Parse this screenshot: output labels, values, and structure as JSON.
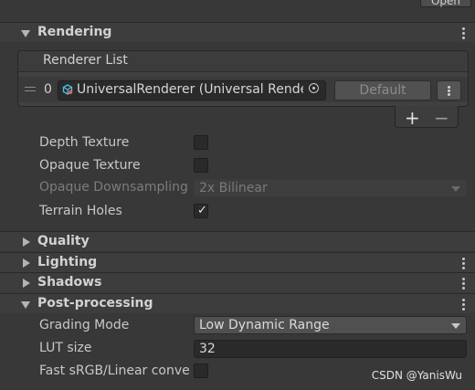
{
  "top": {
    "open_label": "Open"
  },
  "sections": {
    "rendering": "Rendering",
    "quality": "Quality",
    "lighting": "Lighting",
    "shadows": "Shadows",
    "post_processing": "Post-processing"
  },
  "renderer_list": {
    "title": "Renderer List",
    "items": [
      {
        "index": "0",
        "renderer": "UniversalRenderer (Universal Renderer Data)",
        "default_label": "Default"
      }
    ],
    "add_label": "+",
    "remove_label": "−"
  },
  "rendering_props": {
    "depth_texture": {
      "label": "Depth Texture",
      "checked": false
    },
    "opaque_texture": {
      "label": "Opaque Texture",
      "checked": false
    },
    "opaque_downsampling": {
      "label": "Opaque Downsampling",
      "value": "2x Bilinear",
      "disabled": true
    },
    "terrain_holes": {
      "label": "Terrain Holes",
      "checked": true,
      "check_glyph": "✓"
    }
  },
  "post_processing_props": {
    "grading_mode": {
      "label": "Grading Mode",
      "value": "Low Dynamic Range"
    },
    "lut_size": {
      "label": "LUT size",
      "value": "32"
    },
    "fast_srgb": {
      "label": "Fast sRGB/Linear conversion",
      "checked": false
    }
  },
  "watermark": "CSDN @YanisWu"
}
